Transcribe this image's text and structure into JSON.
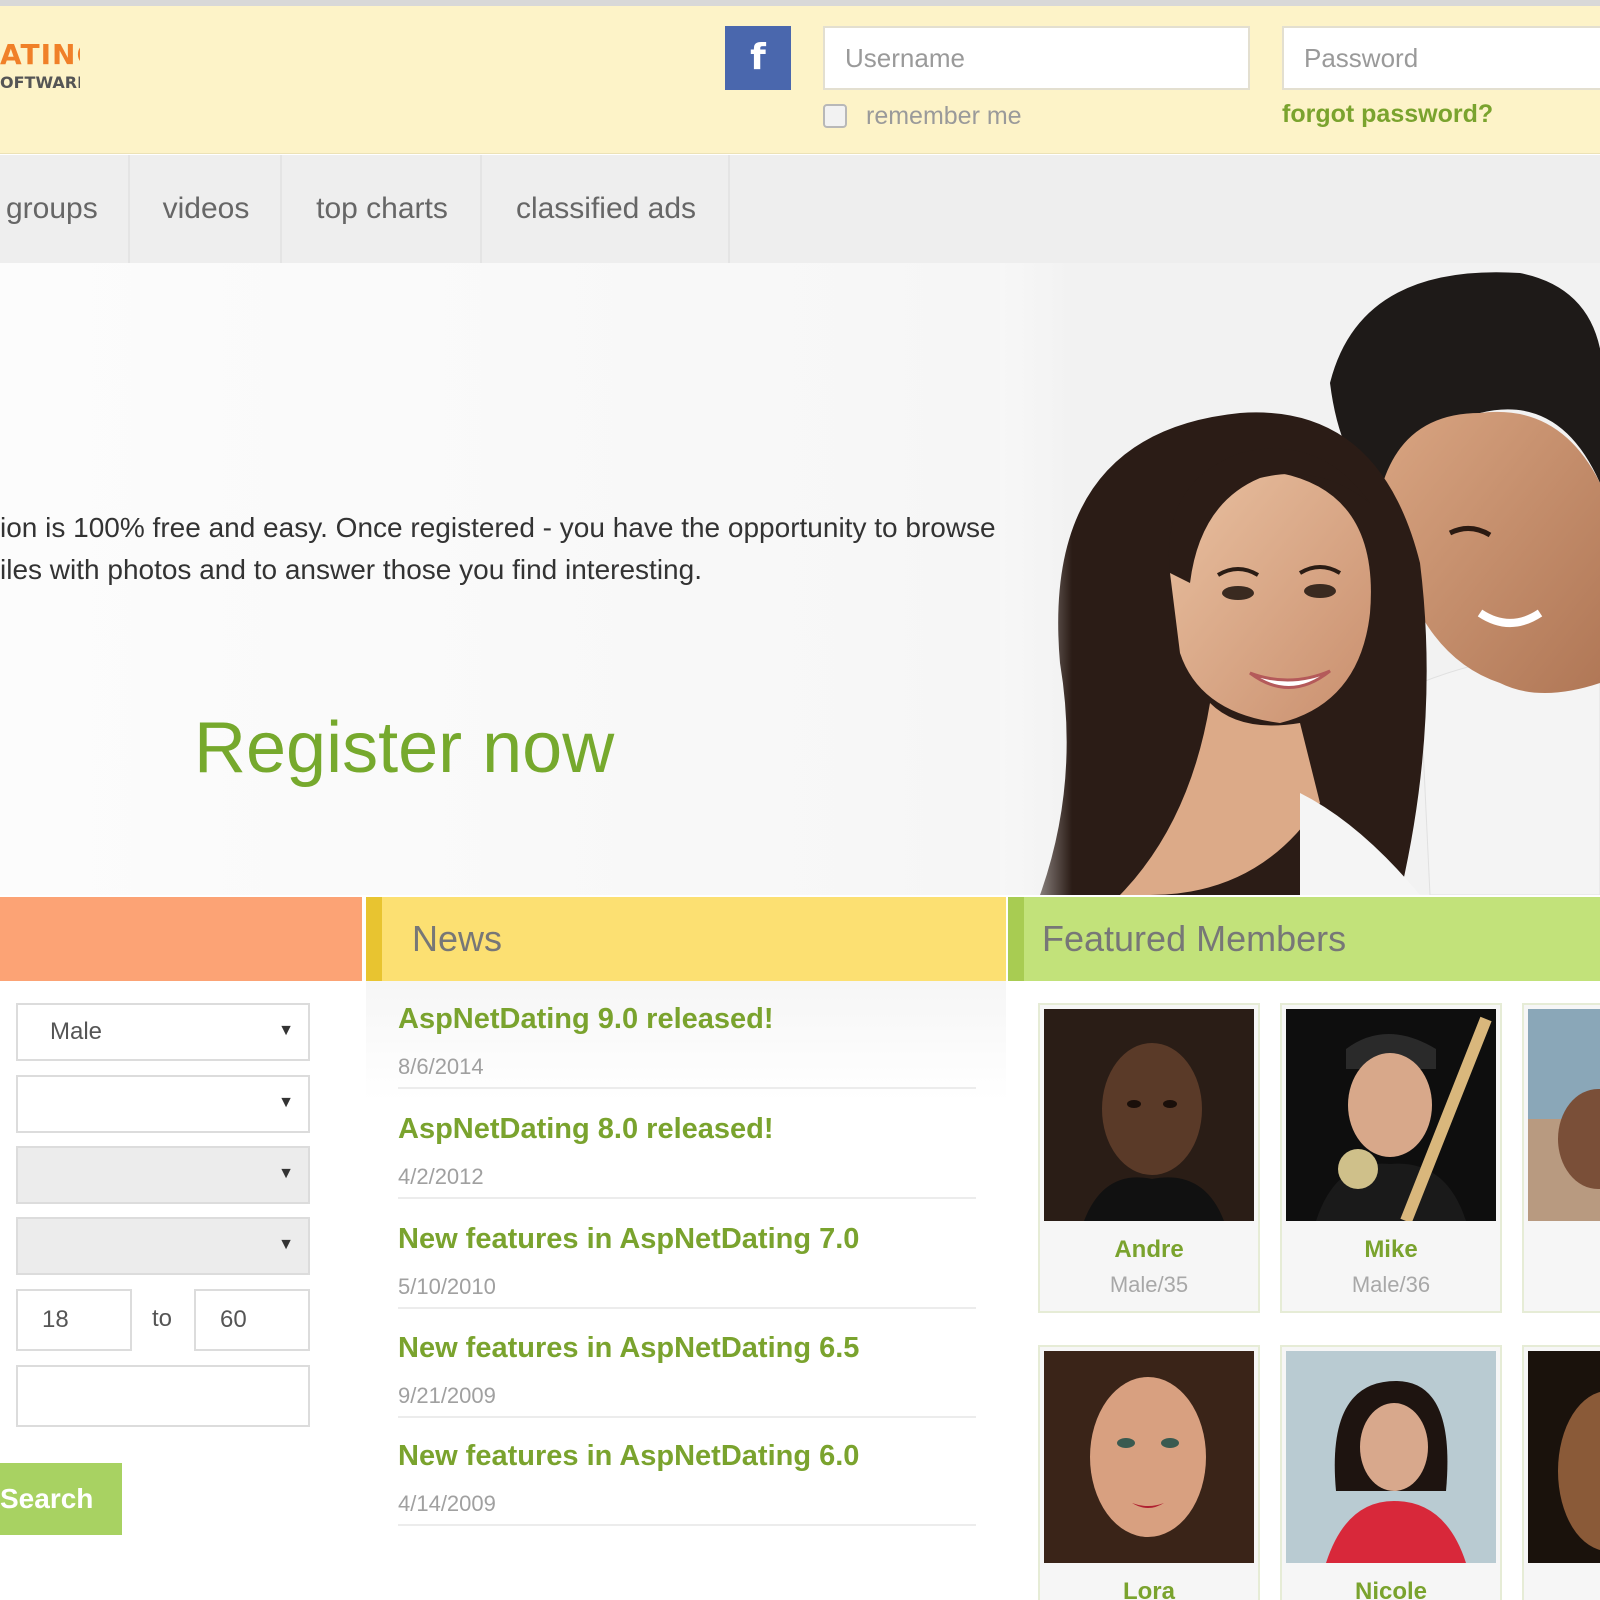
{
  "header": {
    "logo_top": "ATING",
    "logo_bottom": "OFTWARE",
    "facebook_label": "f",
    "username_placeholder": "Username",
    "password_placeholder": "Password",
    "remember_label": "remember me",
    "forgot_label": "forgot password?"
  },
  "nav": {
    "items": [
      {
        "label": "groups"
      },
      {
        "label": "videos"
      },
      {
        "label": "top charts"
      },
      {
        "label": "classified ads"
      }
    ]
  },
  "hero": {
    "text_line1": "ion is 100% free and easy. Once registered - you have the opportunity to browse",
    "text_line2": "iles with photos and to answer those you find interesting.",
    "register_label": "Register now"
  },
  "search": {
    "gender_value": "Male",
    "age_from": "18",
    "age_separator": "to",
    "age_to": "60",
    "button_label": "Search"
  },
  "news": {
    "title": "News",
    "items": [
      {
        "title": "AspNetDating 9.0 released!",
        "date": "8/6/2014"
      },
      {
        "title": "AspNetDating 8.0 released!",
        "date": "4/2/2012"
      },
      {
        "title": "New features in AspNetDating 7.0",
        "date": "5/10/2010"
      },
      {
        "title": "New features in AspNetDating 6.5",
        "date": "9/21/2009"
      },
      {
        "title": "New features in AspNetDating 6.0",
        "date": "4/14/2009"
      }
    ]
  },
  "featured": {
    "title": "Featured Members",
    "members": [
      {
        "name": "Andre",
        "meta": "Male/35"
      },
      {
        "name": "Mike",
        "meta": "Male/36"
      },
      {
        "name": "",
        "meta": ""
      },
      {
        "name": "Lora",
        "meta": ""
      },
      {
        "name": "Nicole",
        "meta": ""
      },
      {
        "name": "",
        "meta": ""
      }
    ]
  },
  "colors": {
    "accent_green": "#7aa32e",
    "header_bg": "#fdf3c8",
    "search_header": "#fca375",
    "news_header": "#fce072",
    "featured_header": "#c2e27a",
    "facebook_blue": "#4a67ad"
  }
}
